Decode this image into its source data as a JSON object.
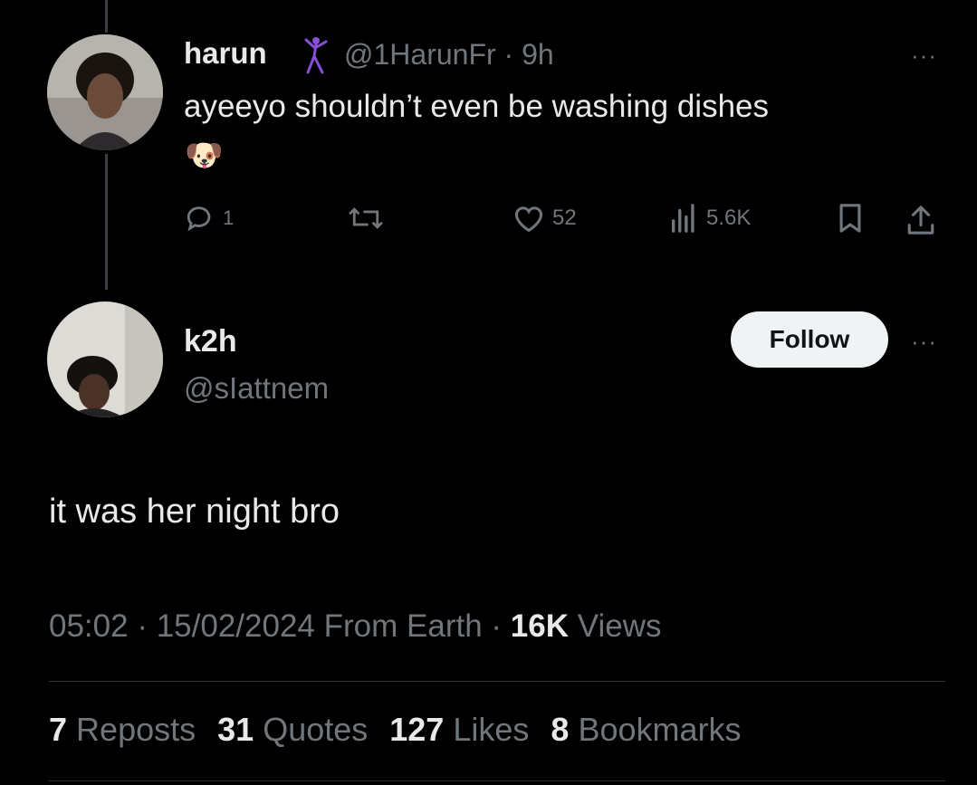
{
  "parent_tweet": {
    "name": "harun",
    "handle": "@1HarunFr",
    "separator": "·",
    "time": "9h",
    "text": "ayeeyo shouldn’t even be washing dishes",
    "emoji": "🐶",
    "actions": {
      "replies": "1",
      "reposts": "",
      "likes": "52",
      "views": "5.6K"
    }
  },
  "main_tweet": {
    "name": "k2h",
    "handle": "@sIattnem",
    "follow_label": "Follow",
    "text": "it was her night bro",
    "time": "05:02",
    "date": "15/02/2024",
    "source": "From Earth",
    "views_count": "16K",
    "views_label": "Views",
    "dot": "·"
  },
  "stats": [
    {
      "count": "7",
      "label": "Reposts"
    },
    {
      "count": "31",
      "label": "Quotes"
    },
    {
      "count": "127",
      "label": "Likes"
    },
    {
      "count": "8",
      "label": "Bookmarks"
    }
  ],
  "more_icon": "···",
  "colors": {
    "background": "#000000",
    "text": "#e7e9ea",
    "secondary": "#71767b",
    "follow_bg": "#eff3f4",
    "badge_purple": "#8a4fd8"
  },
  "icons": [
    "reply-icon",
    "repost-icon",
    "like-icon",
    "views-icon",
    "bookmark-icon",
    "share-icon",
    "more-icon",
    "dancer-badge-icon"
  ]
}
